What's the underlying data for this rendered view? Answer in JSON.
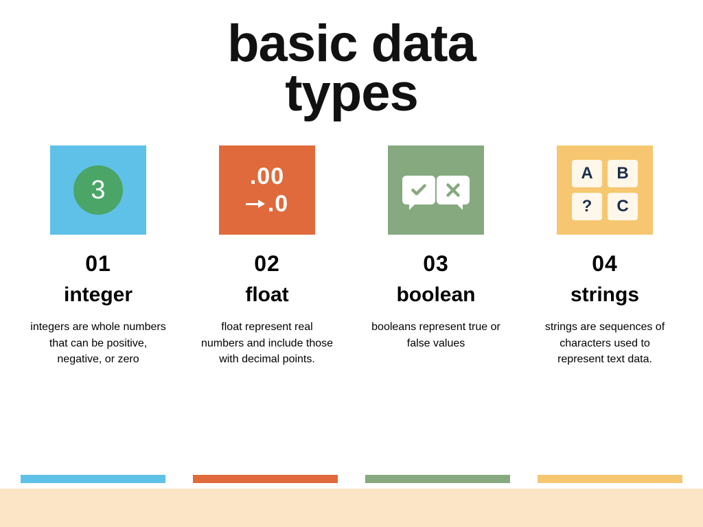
{
  "title_line1": "basic data",
  "title_line2": "types",
  "items": [
    {
      "number": "01",
      "name": "integer",
      "desc": "integers are whole numbers that can be positive, negative, or zero",
      "color": "#5fc1e8",
      "icon": "integer",
      "glyph": "3"
    },
    {
      "number": "02",
      "name": "float",
      "desc": "float represent real numbers and include those with decimal points.",
      "color": "#e06a3b",
      "icon": "float",
      "line1": ".00",
      "line2": ".0"
    },
    {
      "number": "03",
      "name": "boolean",
      "desc": "booleans represent true or false values",
      "color": "#86a97f",
      "icon": "boolean"
    },
    {
      "number": "04",
      "name": "strings",
      "desc": "strings are sequences of characters used to represent text data.",
      "color": "#f6c770",
      "icon": "strings",
      "tiles": [
        "A",
        "B",
        "?",
        "C"
      ]
    }
  ]
}
